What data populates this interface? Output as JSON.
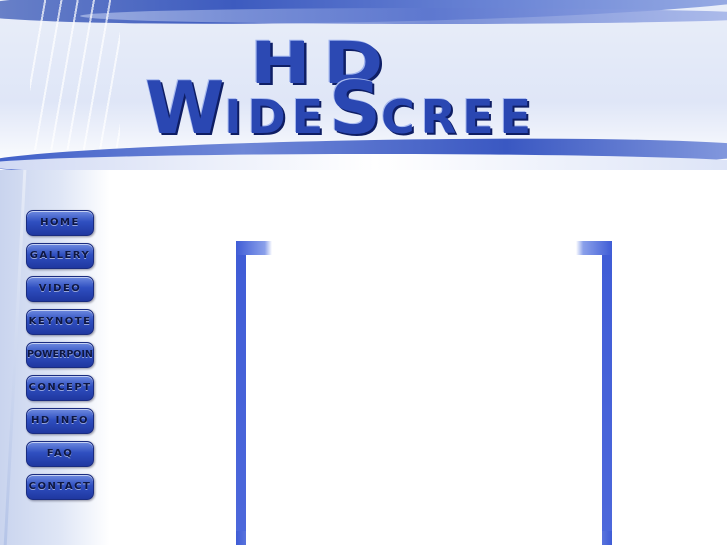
{
  "header": {
    "logo_hd": "HD",
    "logo_w": "W",
    "logo_ide": "IDE",
    "logo_s": "S",
    "logo_creen": "CREE"
  },
  "nav": {
    "home": "HOME",
    "gallery": "GALLERY",
    "video": "VIDEO",
    "keynote": "KEYNOTE",
    "powerpoint": "POWERPOINT",
    "concept": "CONCEPT",
    "hd_info": "HD INFO",
    "faq": "FAQ",
    "contact": "CONTACT"
  },
  "colors": {
    "accent": "#2c49b3",
    "frame": "#3f5cd6",
    "background": "#ffffff"
  }
}
